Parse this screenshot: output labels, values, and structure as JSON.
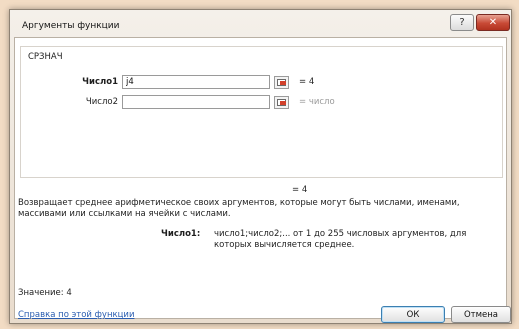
{
  "window": {
    "title": "Аргументы функции",
    "help_glyph": "?",
    "close_glyph": "✕"
  },
  "function_name": "СРЗНАЧ",
  "args": [
    {
      "label": "Число1",
      "value": "j4",
      "result": "= 4"
    },
    {
      "label": "Число2",
      "value": "",
      "result": "= число"
    }
  ],
  "overall_result": "= 4",
  "description": "Возвращает среднее арифметическое своих аргументов, которые могут быть числами, именами, массивами или ссылками на ячейки с числами.",
  "arg_help": {
    "label": "Число1:",
    "text": "число1;число2;... от 1 до 255 числовых аргументов, для которых вычисляется среднее."
  },
  "value_line": "Значение: 4",
  "help_link": "Справка по этой функции",
  "buttons": {
    "ok": "ОК",
    "cancel": "Отмена"
  },
  "colors": {
    "accent": "#2a5db0",
    "close": "#c84a36",
    "background": "#f2dcc4"
  }
}
